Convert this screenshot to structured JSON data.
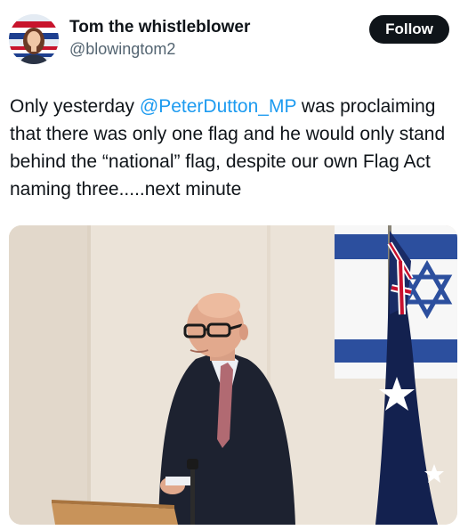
{
  "author": {
    "display_name": "Tom the whistleblower",
    "handle": "@blowingtom2",
    "avatar_icon": "profile-photo"
  },
  "follow_button": {
    "label": "Follow"
  },
  "tweet": {
    "text_before": "Only yesterday ",
    "mention": "@PeterDutton_MP",
    "text_after": " was proclaiming that there was only one flag and he would only stand behind the “national” flag, despite our own Flag Act naming three.....next minute"
  },
  "media": {
    "alt": ""
  },
  "colors": {
    "link": "#1d9bf0",
    "text": "#0f1419",
    "secondary_text": "#536471",
    "follow_bg": "#0f1419",
    "flag_blue": "#2c4f9e",
    "aus_flag_navy": "#13214f"
  }
}
